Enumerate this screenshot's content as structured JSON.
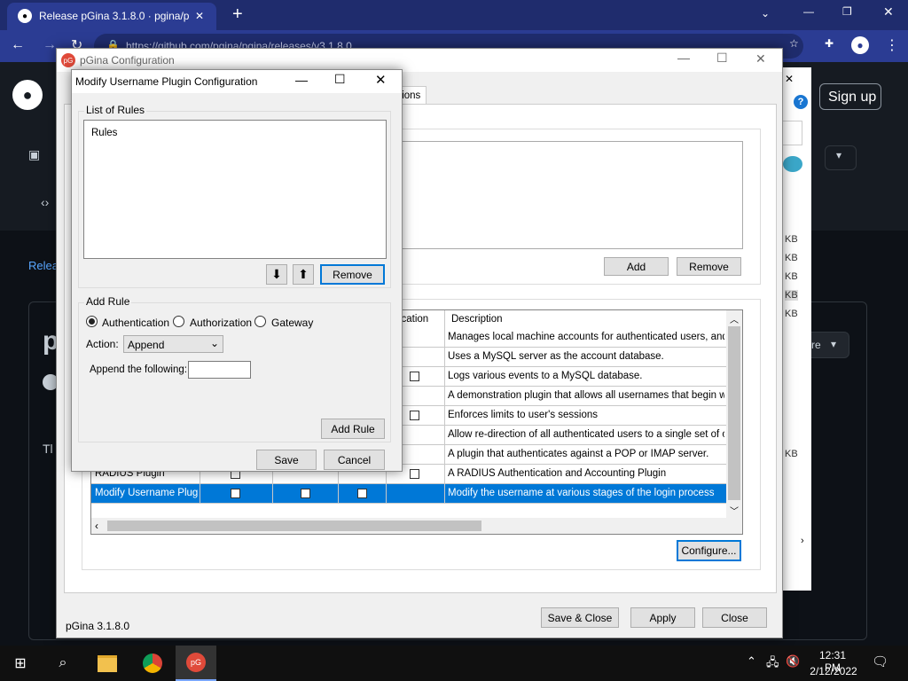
{
  "browser": {
    "tab_title": "Release pGina 3.1.8.0 · pgina/pgi",
    "tab_close": "✕",
    "new_tab": "+",
    "url": "https://github.com/pgina/pgina/releases/v3.1.8.0"
  },
  "github": {
    "sign_up": "Sign up",
    "release_link": "Relea",
    "heading_fragment": "p",
    "body_fragment": "Tl",
    "side_sizes": [
      "KB",
      "KB",
      "KB",
      "KB",
      "KB",
      "KB"
    ],
    "dropdown_fragment": "re"
  },
  "main_window": {
    "title": "pGina Configuration",
    "tab_fragment": "tions",
    "add_button": "Add",
    "remove_button": "Remove",
    "columns": [
      "",
      "",
      "",
      "",
      "tification",
      "Description"
    ],
    "plugins": [
      {
        "name": "",
        "checks": [
          false,
          false,
          false,
          false
        ],
        "description": "Manages local machine accounts for authenticated users, and auth"
      },
      {
        "name": "",
        "checks": [
          false,
          false,
          false,
          false
        ],
        "description": "Uses a MySQL server as the account database."
      },
      {
        "name": "",
        "checks": [
          false,
          false,
          false,
          true
        ],
        "description": "Logs various events to a MySQL database."
      },
      {
        "name": "",
        "checks": [
          false,
          false,
          false,
          false
        ],
        "description": "A demonstration plugin that allows all usernames that begin with the"
      },
      {
        "name": "",
        "checks": [
          false,
          false,
          false,
          true
        ],
        "description": "Enforces limits to user's sessions"
      },
      {
        "name": "",
        "checks": [
          false,
          false,
          false,
          false
        ],
        "description": "Allow re-direction of all authenticated users to a single set of creder"
      },
      {
        "name": "",
        "checks": [
          false,
          false,
          false,
          false
        ],
        "description": "A plugin that authenticates against a POP or IMAP server."
      },
      {
        "name": "RADIUS Plugin",
        "checks": [
          true,
          false,
          false,
          true
        ],
        "description": "A RADIUS Authentication and Accounting Plugin"
      },
      {
        "name": "Modify Username Plugin",
        "checks": [
          true,
          true,
          true,
          false
        ],
        "description": "Modify the username at various stages of the login process"
      }
    ],
    "configure_button": "Configure...",
    "version": "pGina 3.1.8.0",
    "save_close_button": "Save & Close",
    "apply_button": "Apply",
    "close_button": "Close"
  },
  "dialog": {
    "title": "Modify Username Plugin Configuration",
    "list_group": "List of Rules",
    "rules_header": "Rules",
    "remove_button": "Remove",
    "add_group": "Add Rule",
    "radios": [
      {
        "label": "Authentication",
        "checked": true
      },
      {
        "label": "Authorization",
        "checked": false
      },
      {
        "label": "Gateway",
        "checked": false
      }
    ],
    "action_label": "Action:",
    "action_value": "Append",
    "append_label": "Append the following:",
    "append_value": "",
    "add_rule_button": "Add Rule",
    "save_button": "Save",
    "cancel_button": "Cancel"
  },
  "taskbar": {
    "time": "12:31 PM",
    "date": "2/12/2022"
  },
  "colors": {
    "accent": "#0078d7",
    "chrome_frame": "#1f2c6d",
    "chrome_toolbar": "#2b3c93"
  }
}
